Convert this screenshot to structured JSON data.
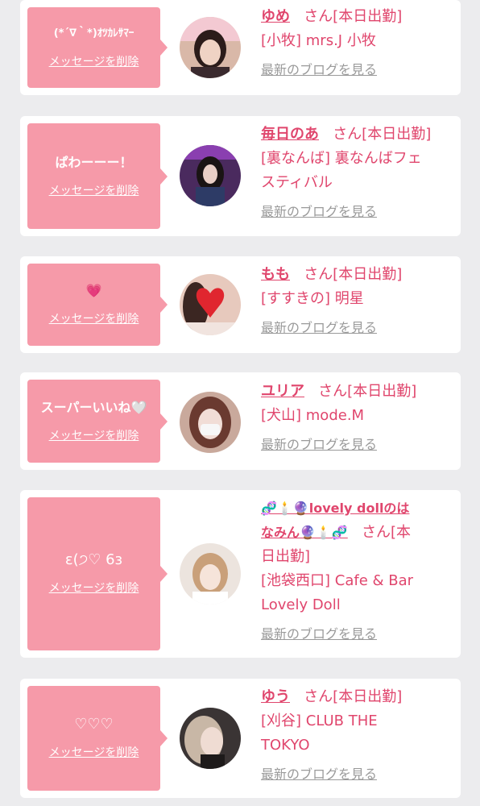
{
  "colors": {
    "background": "#ececee",
    "card": "#ffffff",
    "bubble": "#f69aa9",
    "accent": "#e0466d",
    "link_gray": "#9a9a9a"
  },
  "common": {
    "delete_label": "メッセージを削除",
    "blog_label": "最新のブログを見る",
    "san_label": "さん[本日出勤]"
  },
  "items": [
    {
      "message": "(*´∇｀*)ｵﾂｶﾚｻﾏｰ",
      "name": "ゆめ",
      "shop_line1": "[小牧] mrs.J 小牧",
      "shop_line2": ""
    },
    {
      "message": "ぱわーーー！",
      "name": "毎日のあ",
      "shop_line1": "[裏なんば] 裏なんばフェ",
      "shop_line2": "スティバル"
    },
    {
      "message": "💗",
      "name": "もも",
      "shop_line1": "[すすきの] 明星",
      "shop_line2": ""
    },
    {
      "message": "スーパーいいね🤍",
      "name": "ユリア",
      "shop_line1": "[犬山] mode.M",
      "shop_line2": ""
    },
    {
      "message": "ɛ(੭♡ 6з",
      "name_line1": "🧬🕯️🔮lovely dollのは",
      "name_line2": "なみん🔮🕯️🧬",
      "san_line1": "さん[本",
      "san_line2": "日出勤]",
      "shop_line1": "[池袋西口] Cafe & Bar",
      "shop_line2": "Lovely Doll"
    },
    {
      "message": "♡♡♡",
      "name": "ゆう",
      "shop_line1": "[刈谷] CLUB THE",
      "shop_line2": "TOKYO"
    }
  ]
}
